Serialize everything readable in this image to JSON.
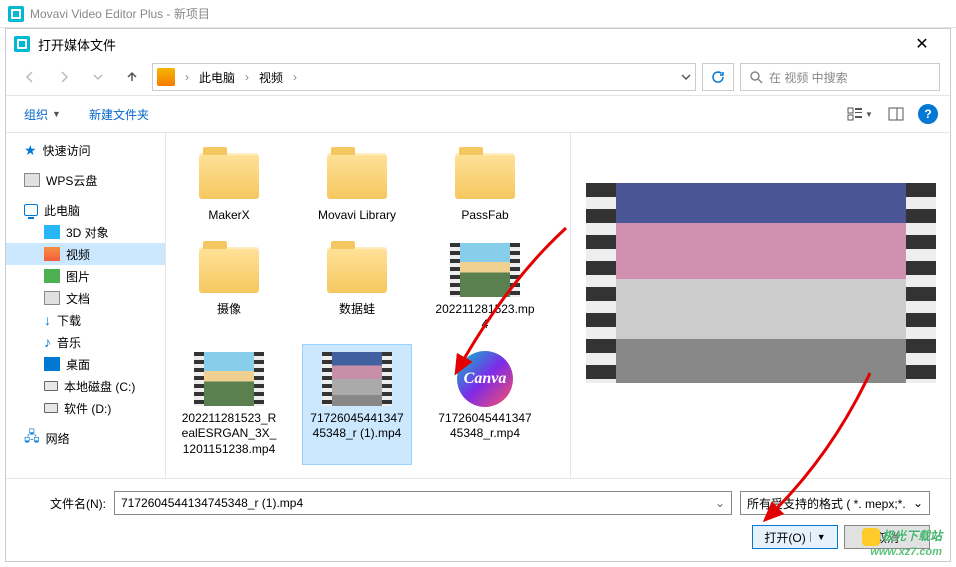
{
  "app": {
    "title": "Movavi Video Editor Plus - 新项目"
  },
  "dialog": {
    "title": "打开媒体文件",
    "breadcrumb": {
      "root": "此电脑",
      "folder": "视频"
    },
    "search_placeholder": "在 视频 中搜索",
    "toolbar": {
      "organize": "组织",
      "new_folder": "新建文件夹"
    },
    "filename_label": "文件名(N):",
    "filename_value": "7172604544134745348_r (1).mp4",
    "filter": "所有受支持的格式 ( *. mepx;*.",
    "open_btn": "打开(O)",
    "cancel_btn": "取消"
  },
  "sidebar": {
    "quick": "快速访问",
    "wps": "WPS云盘",
    "pc": "此电脑",
    "three_d": "3D 对象",
    "video": "视频",
    "pictures": "图片",
    "documents": "文档",
    "downloads": "下载",
    "music": "音乐",
    "desktop": "桌面",
    "drive_c": "本地磁盘 (C:)",
    "drive_d": "软件 (D:)",
    "network": "网络"
  },
  "files": [
    {
      "name": "MakerX",
      "type": "folder"
    },
    {
      "name": "Movavi Library",
      "type": "folder"
    },
    {
      "name": "PassFab",
      "type": "folder"
    },
    {
      "name": "摄像",
      "type": "folder"
    },
    {
      "name": "数据蛙",
      "type": "folder"
    },
    {
      "name": "202211281523.mp4",
      "type": "video"
    },
    {
      "name": "202211281523_RealESRGAN_3X_1201151238.mp4",
      "type": "video"
    },
    {
      "name": "7172604544134745348_r (1).mp4",
      "type": "video-dark",
      "selected": true
    },
    {
      "name": "7172604544134745348_r.mp4",
      "type": "canva"
    }
  ],
  "watermark": {
    "line1": "极光下载站",
    "line2": "www.xz7.com"
  }
}
